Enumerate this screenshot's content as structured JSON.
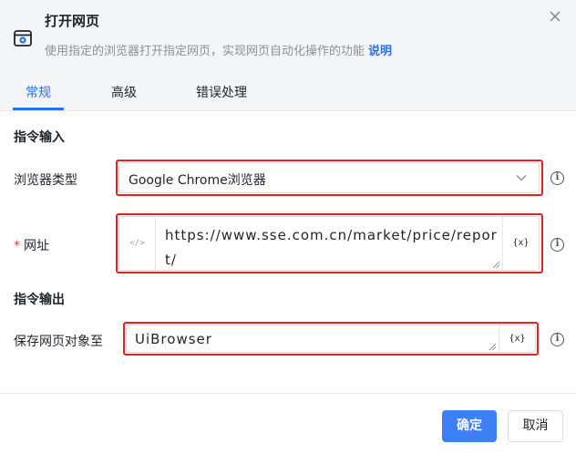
{
  "dialog": {
    "title": "打开网页",
    "description": "使用指定的浏览器打开指定网页，实现网页自动化操作的功能",
    "help_link": "说明",
    "close_icon": "close-icon"
  },
  "tabs": [
    {
      "label": "常规",
      "active": true
    },
    {
      "label": "高级",
      "active": false
    },
    {
      "label": "错误处理",
      "active": false
    }
  ],
  "input_section": {
    "title": "指令输入",
    "browser_type": {
      "label": "浏览器类型",
      "value": "Google Chrome浏览器"
    },
    "url": {
      "required_mark": "*",
      "label": "网址",
      "code_toggle": "</>",
      "value": "https://www.sse.com.cn/market/price/report/",
      "var_button": "{x}"
    }
  },
  "output_section": {
    "title": "指令输出",
    "save_to": {
      "label": "保存网页对象至",
      "value": "UiBrowser",
      "var_button": "{x}"
    }
  },
  "footer": {
    "ok_label": "确定",
    "cancel_label": "取消"
  },
  "colors": {
    "accent": "#2b6ff5",
    "highlight_frame": "#e3231f",
    "required": "#e8373b",
    "header_bg": "#f4f5f7"
  }
}
